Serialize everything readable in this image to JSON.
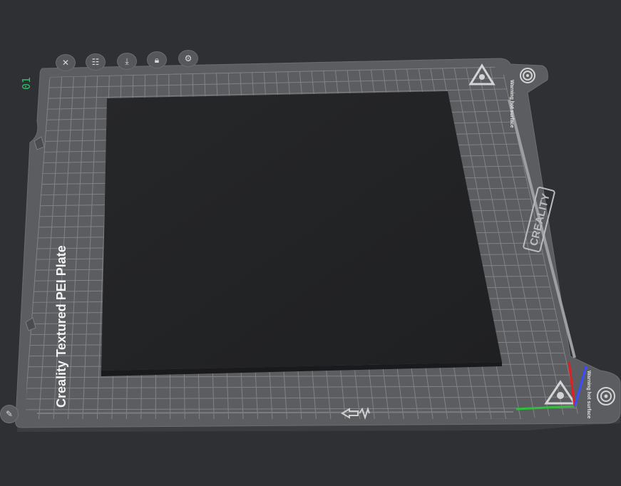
{
  "plate": {
    "index": "01",
    "label": "Creality Textured PEI Plate",
    "brand": "CREALITY",
    "warning_top": "Warning hot surface",
    "warning_bottom": "Warning hot surface"
  },
  "toolbar": {
    "buttons": [
      {
        "name": "close",
        "icon": "close-icon"
      },
      {
        "name": "arrange",
        "icon": "grid-icon"
      },
      {
        "name": "auto-orient",
        "icon": "orient-icon"
      },
      {
        "name": "lock",
        "icon": "lock-icon"
      },
      {
        "name": "settings",
        "icon": "gear-icon"
      }
    ]
  },
  "colors": {
    "background": "#2f3033",
    "plate": "#5b5d61",
    "grid": "#8a8c90",
    "model": "#232426",
    "accent_green": "#27c46a",
    "axis_x": "#2fbf3a",
    "axis_y": "#3a4cff",
    "axis_z": "#e02020"
  }
}
